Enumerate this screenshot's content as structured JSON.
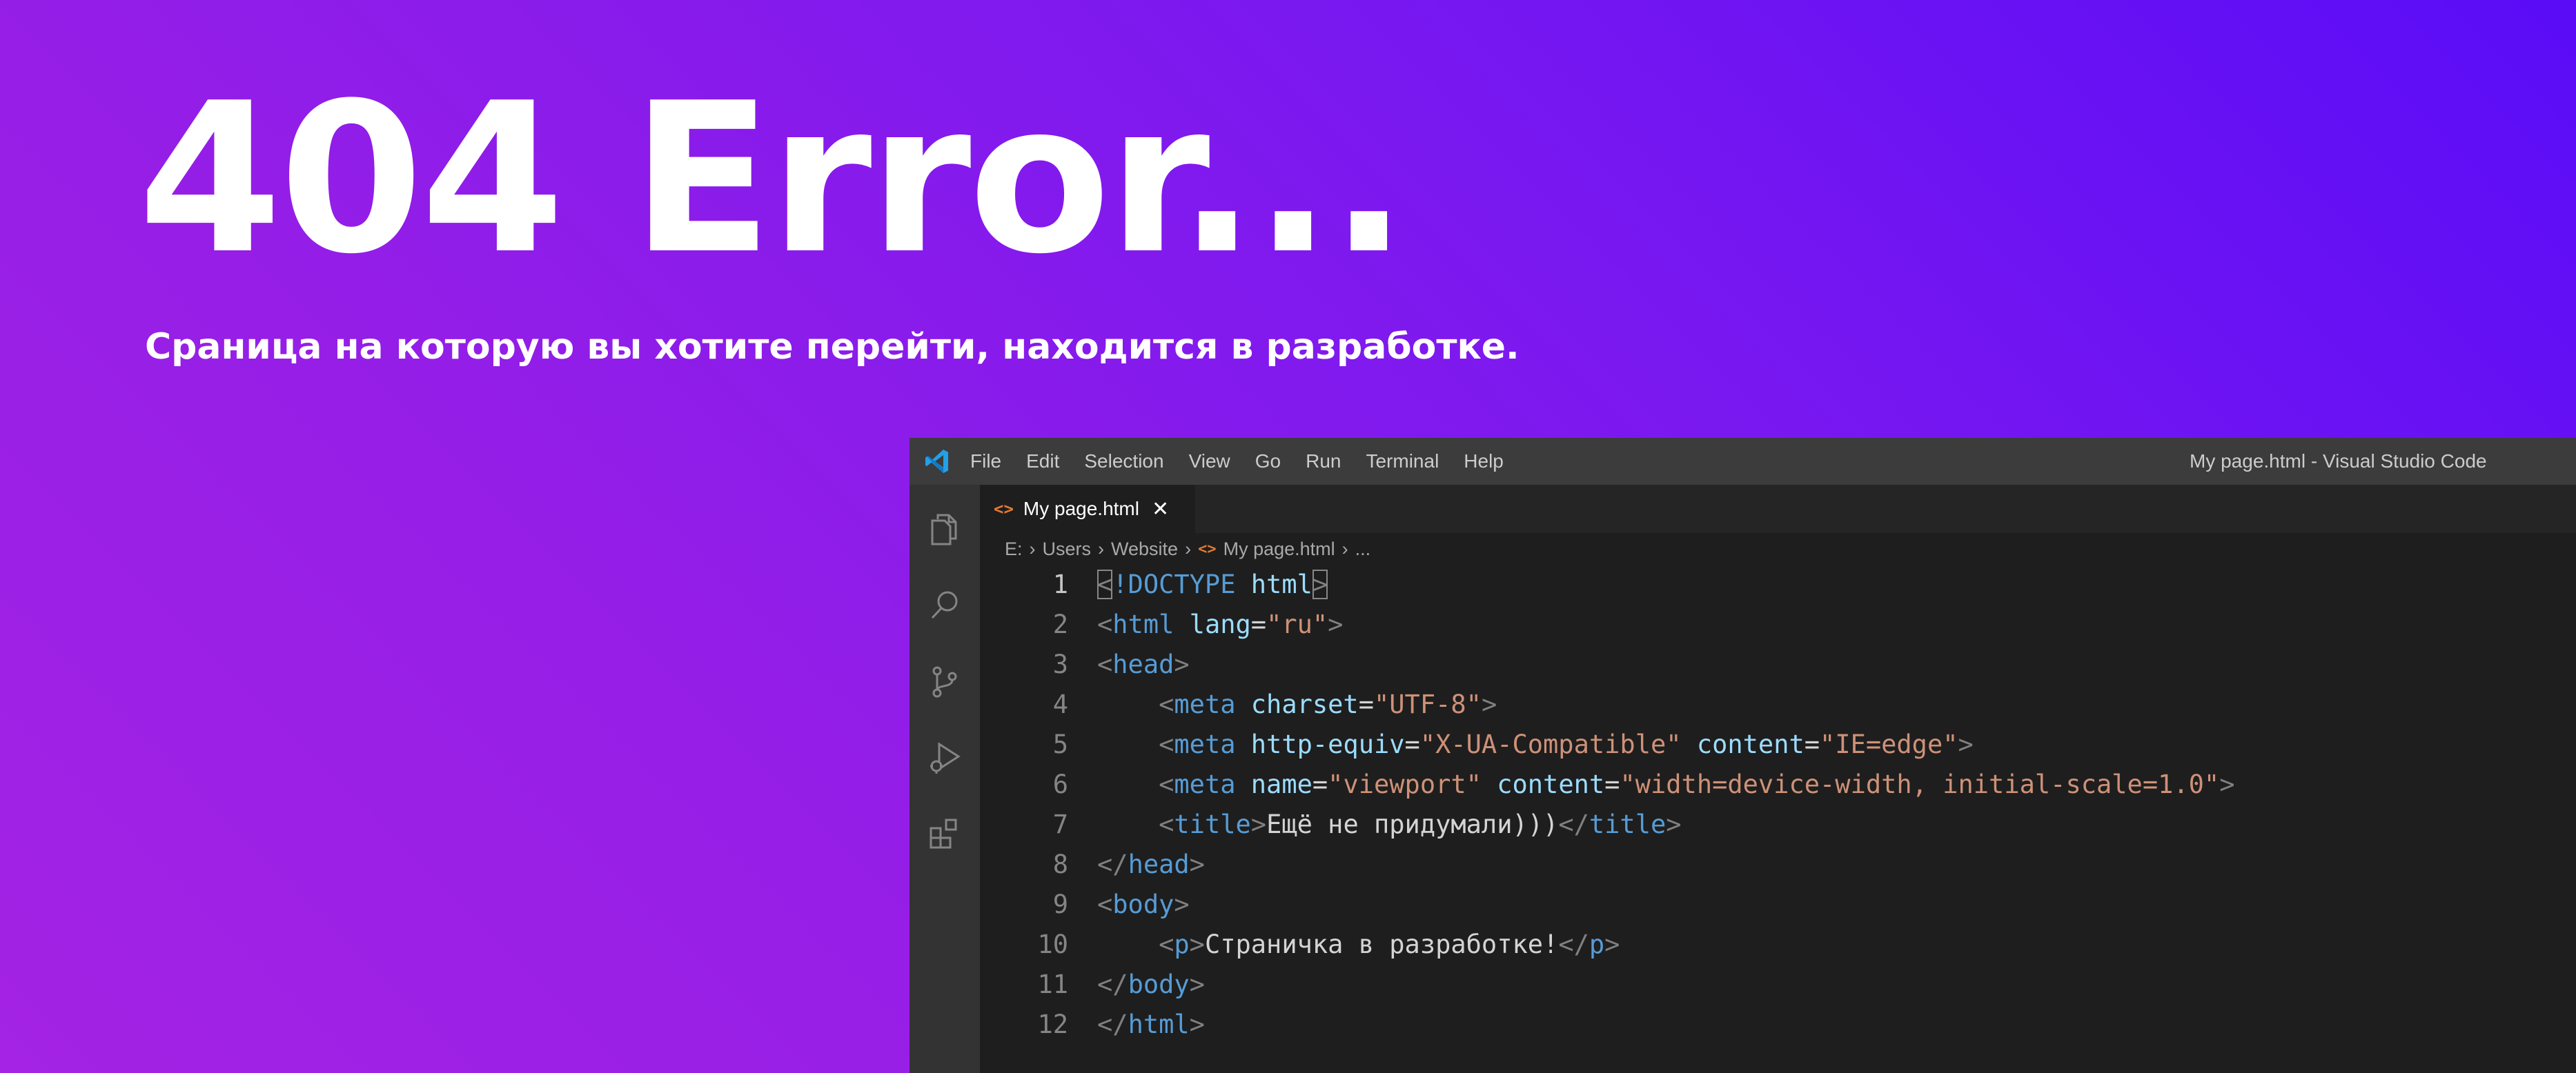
{
  "hero": {
    "title": "404 Error...",
    "subtitle": "Сраница на которую вы хотите перейти, находится в разработке."
  },
  "window": {
    "title": "My page.html - Visual Studio Code",
    "logo_icon": "vscode-logo-icon",
    "menu": [
      "File",
      "Edit",
      "Selection",
      "View",
      "Go",
      "Run",
      "Terminal",
      "Help"
    ]
  },
  "activity_bar": {
    "icons": [
      "explorer-icon",
      "search-icon",
      "source-control-icon",
      "run-debug-icon",
      "extensions-icon"
    ]
  },
  "tab": {
    "label": "My page.html",
    "file_icon": "html-file-icon",
    "close_icon": "close-icon"
  },
  "breadcrumb": {
    "items": [
      "E:",
      "Users",
      "Website",
      "My page.html",
      "..."
    ]
  },
  "editor": {
    "active_line": 1,
    "lines": [
      {
        "no": "1",
        "indent": "",
        "tokens": [
          {
            "t": "punct",
            "v": "<"
          },
          {
            "t": "tag",
            "v": "!DOCTYPE"
          },
          {
            "t": "text",
            "v": " "
          },
          {
            "t": "attr",
            "v": "html"
          },
          {
            "t": "punct",
            "v": ">"
          }
        ]
      },
      {
        "no": "2",
        "indent": "",
        "tokens": [
          {
            "t": "punct",
            "v": "<"
          },
          {
            "t": "tag",
            "v": "html"
          },
          {
            "t": "text",
            "v": " "
          },
          {
            "t": "attr",
            "v": "lang"
          },
          {
            "t": "text",
            "v": "="
          },
          {
            "t": "str",
            "v": "\"ru\""
          },
          {
            "t": "punct",
            "v": ">"
          }
        ]
      },
      {
        "no": "3",
        "indent": "",
        "tokens": [
          {
            "t": "punct",
            "v": "<"
          },
          {
            "t": "tag",
            "v": "head"
          },
          {
            "t": "punct",
            "v": ">"
          }
        ]
      },
      {
        "no": "4",
        "indent": "    ",
        "tokens": [
          {
            "t": "punct",
            "v": "<"
          },
          {
            "t": "tag",
            "v": "meta"
          },
          {
            "t": "text",
            "v": " "
          },
          {
            "t": "attr",
            "v": "charset"
          },
          {
            "t": "text",
            "v": "="
          },
          {
            "t": "str",
            "v": "\"UTF-8\""
          },
          {
            "t": "punct",
            "v": ">"
          }
        ]
      },
      {
        "no": "5",
        "indent": "    ",
        "tokens": [
          {
            "t": "punct",
            "v": "<"
          },
          {
            "t": "tag",
            "v": "meta"
          },
          {
            "t": "text",
            "v": " "
          },
          {
            "t": "attr",
            "v": "http-equiv"
          },
          {
            "t": "text",
            "v": "="
          },
          {
            "t": "str",
            "v": "\"X-UA-Compatible\""
          },
          {
            "t": "text",
            "v": " "
          },
          {
            "t": "attr",
            "v": "content"
          },
          {
            "t": "text",
            "v": "="
          },
          {
            "t": "str",
            "v": "\"IE=edge\""
          },
          {
            "t": "punct",
            "v": ">"
          }
        ]
      },
      {
        "no": "6",
        "indent": "    ",
        "tokens": [
          {
            "t": "punct",
            "v": "<"
          },
          {
            "t": "tag",
            "v": "meta"
          },
          {
            "t": "text",
            "v": " "
          },
          {
            "t": "attr",
            "v": "name"
          },
          {
            "t": "text",
            "v": "="
          },
          {
            "t": "str",
            "v": "\"viewport\""
          },
          {
            "t": "text",
            "v": " "
          },
          {
            "t": "attr",
            "v": "content"
          },
          {
            "t": "text",
            "v": "="
          },
          {
            "t": "str",
            "v": "\"width=device-width, initial-scale=1.0\""
          },
          {
            "t": "punct",
            "v": ">"
          }
        ]
      },
      {
        "no": "7",
        "indent": "    ",
        "tokens": [
          {
            "t": "punct",
            "v": "<"
          },
          {
            "t": "tag",
            "v": "title"
          },
          {
            "t": "punct",
            "v": ">"
          },
          {
            "t": "text",
            "v": "Ещё не придумали)))"
          },
          {
            "t": "punct",
            "v": "</"
          },
          {
            "t": "tag",
            "v": "title"
          },
          {
            "t": "punct",
            "v": ">"
          }
        ]
      },
      {
        "no": "8",
        "indent": "",
        "tokens": [
          {
            "t": "punct",
            "v": "</"
          },
          {
            "t": "tag",
            "v": "head"
          },
          {
            "t": "punct",
            "v": ">"
          }
        ]
      },
      {
        "no": "9",
        "indent": "",
        "tokens": [
          {
            "t": "punct",
            "v": "<"
          },
          {
            "t": "tag",
            "v": "body"
          },
          {
            "t": "punct",
            "v": ">"
          }
        ]
      },
      {
        "no": "10",
        "indent": "    ",
        "tokens": [
          {
            "t": "punct",
            "v": "<"
          },
          {
            "t": "tag",
            "v": "p"
          },
          {
            "t": "punct",
            "v": ">"
          },
          {
            "t": "text",
            "v": "Страничка в разработке!"
          },
          {
            "t": "punct",
            "v": "</"
          },
          {
            "t": "tag",
            "v": "p"
          },
          {
            "t": "punct",
            "v": ">"
          }
        ]
      },
      {
        "no": "11",
        "indent": "",
        "tokens": [
          {
            "t": "punct",
            "v": "</"
          },
          {
            "t": "tag",
            "v": "body"
          },
          {
            "t": "punct",
            "v": ">"
          }
        ]
      },
      {
        "no": "12",
        "indent": "",
        "tokens": [
          {
            "t": "punct",
            "v": "</"
          },
          {
            "t": "tag",
            "v": "html"
          },
          {
            "t": "punct",
            "v": ">"
          }
        ]
      }
    ]
  },
  "colors": {
    "gradient_start": "#5a0cf7",
    "gradient_end": "#a423e4",
    "editor_bg": "#1e1e1e",
    "titlebar_bg": "#3c3c3c",
    "activitybar_bg": "#333333",
    "tag": "#569cd6",
    "attribute": "#9cdcfe",
    "string": "#ce9178",
    "html_icon": "#e37933"
  }
}
